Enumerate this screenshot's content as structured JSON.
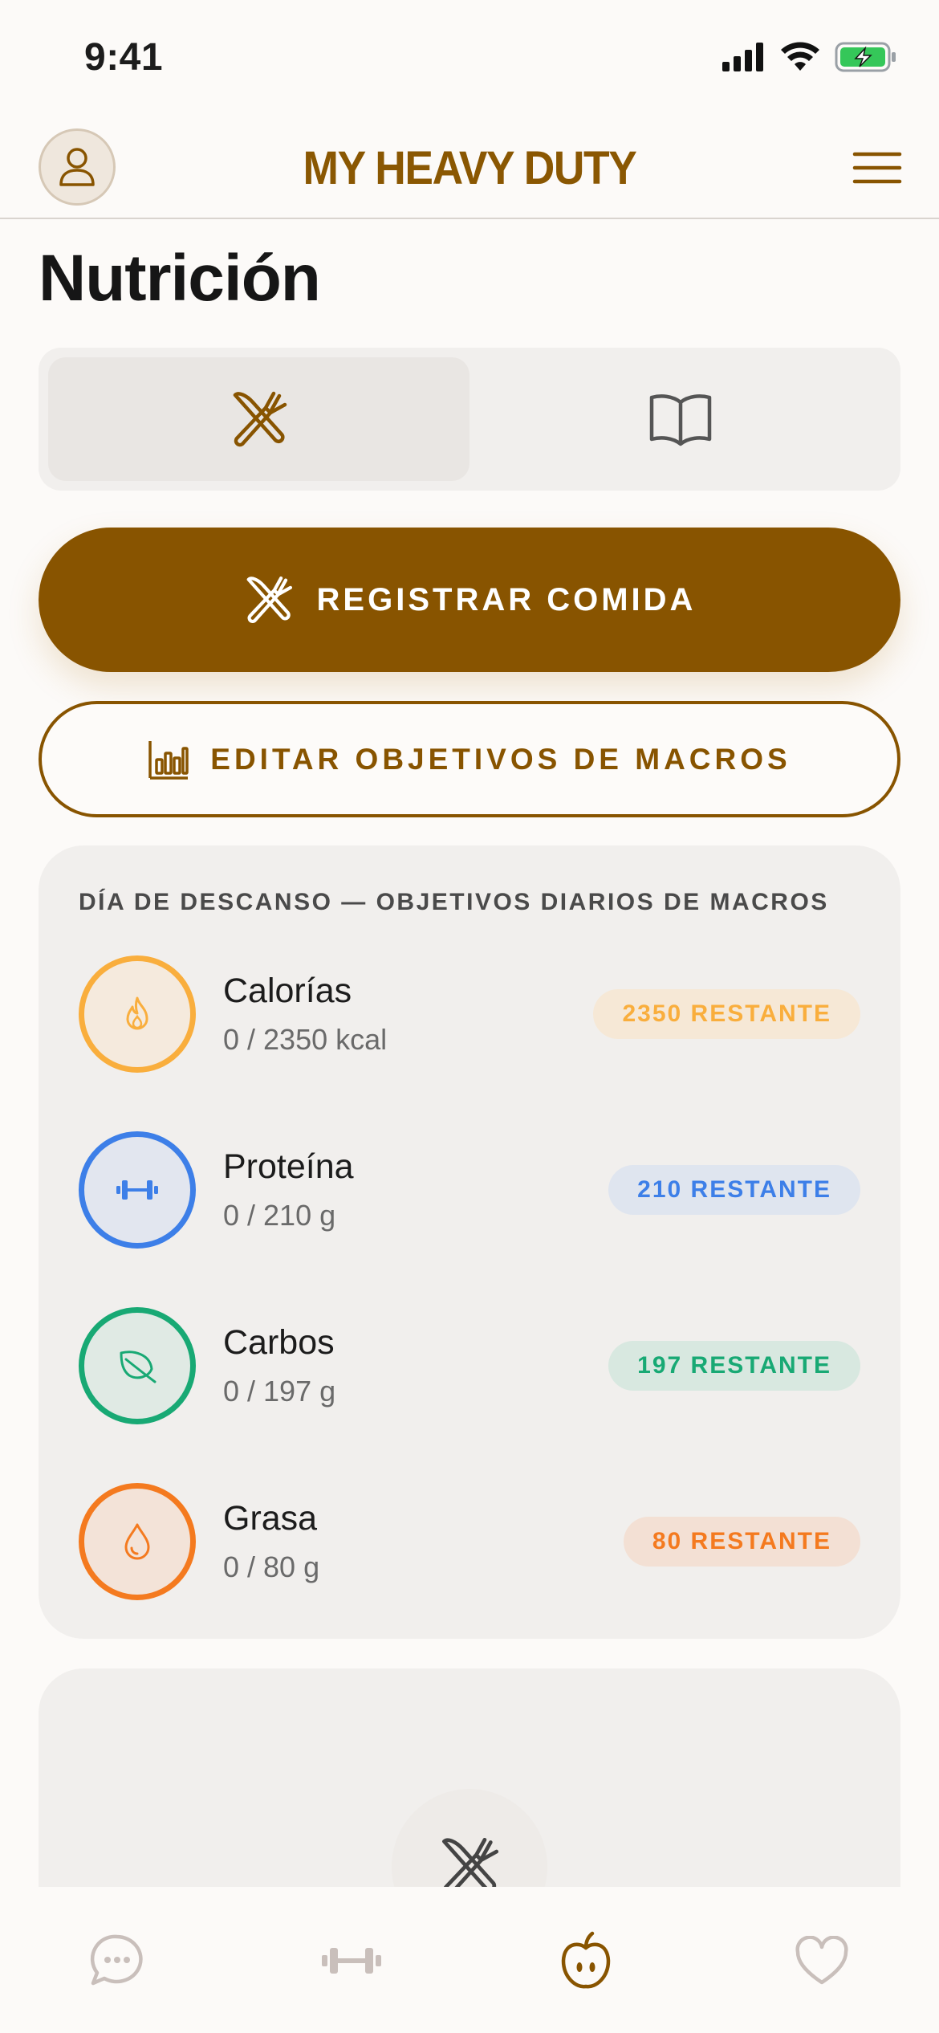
{
  "status_bar": {
    "time": "9:41"
  },
  "header": {
    "title": "MY HEAVY DUTY"
  },
  "page": {
    "title": "Nutrición"
  },
  "segments": [
    {
      "icon": "utensils-icon",
      "active": true
    },
    {
      "icon": "book-icon",
      "active": false
    }
  ],
  "actions": {
    "log_meal_label": "REGISTRAR COMIDA",
    "edit_macros_label": "EDITAR OBJETIVOS DE MACROS"
  },
  "macro_card": {
    "heading": "DÍA DE DESCANSO — OBJETIVOS DIARIOS DE MACROS",
    "macros": [
      {
        "name": "Calorías",
        "value": "0 / 2350 kcal",
        "remaining": "2350 RESTANTE",
        "icon": "flame-icon",
        "color": "#f9ae3d",
        "pill_bg": "#f6e8d6"
      },
      {
        "name": "Proteína",
        "value": "0 / 210 g",
        "remaining": "210 RESTANTE",
        "icon": "dumbbell-icon",
        "color": "#3d7fe8",
        "pill_bg": "#dfe5ef"
      },
      {
        "name": "Carbos",
        "value": "0 / 197 g",
        "remaining": "197 RESTANTE",
        "icon": "leaf-icon",
        "color": "#18a974",
        "pill_bg": "#d8e8e0"
      },
      {
        "name": "Grasa",
        "value": "0 / 80 g",
        "remaining": "80 RESTANTE",
        "icon": "drop-icon",
        "color": "#f47a1f",
        "pill_bg": "#f3e0d4"
      }
    ]
  },
  "colors": {
    "accent": "#885400",
    "background": "#fcfaf8",
    "card": "#f1efed"
  },
  "tab_bar": {
    "items": [
      {
        "icon": "chat-icon",
        "active": false
      },
      {
        "icon": "dumbbell-icon",
        "active": false
      },
      {
        "icon": "apple-icon",
        "active": true
      },
      {
        "icon": "heart-icon",
        "active": false
      }
    ]
  }
}
